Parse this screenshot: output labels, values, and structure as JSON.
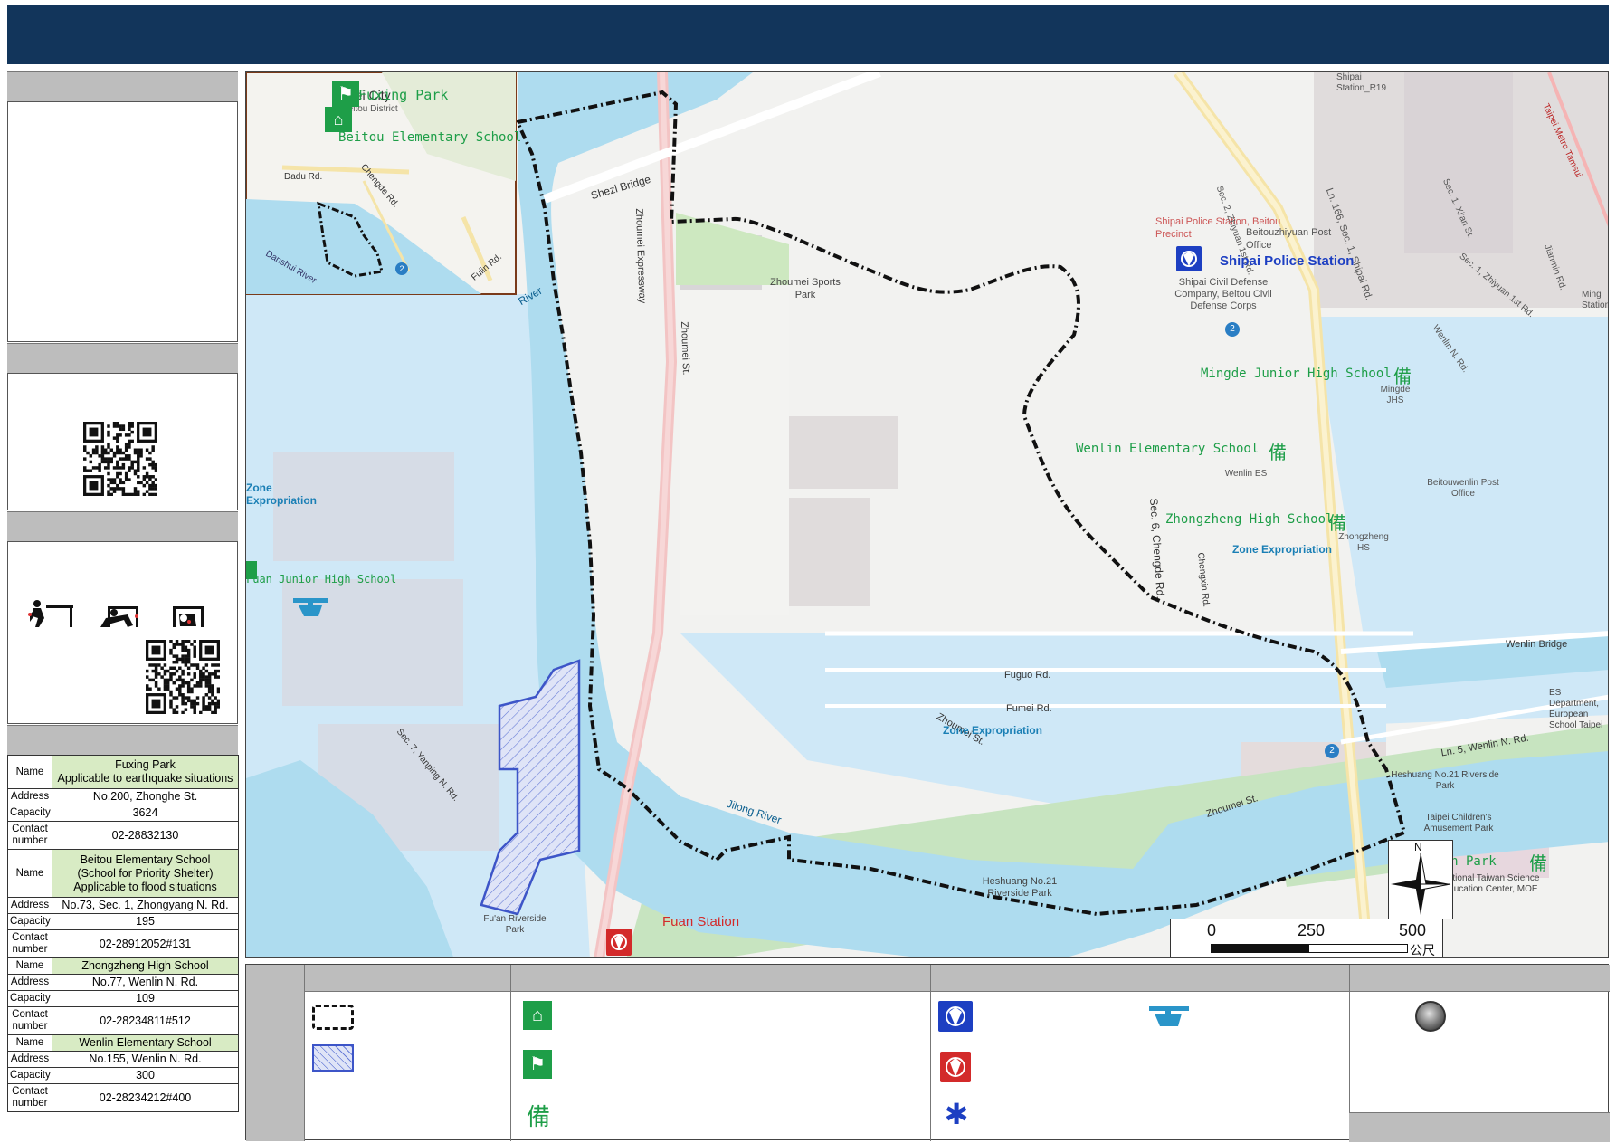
{
  "map": {
    "labels": {
      "fuxing_park": "Fuxing Park",
      "beitou_es": "Beitou Elementary School",
      "taipei_city": "Taipei City",
      "beitou_district": "Beitou District",
      "dadu_rd": "Dadu Rd.",
      "chengde_rd_inset": "Chengde Rd.",
      "danshui_river": "Danshui River",
      "fulin_rd": "Fulin Rd.",
      "shezi_bridge": "Shezi Bridge",
      "zhoumei_expwy": "Zhoumei Expressway",
      "zhoumei_st": "Zhoumei St.",
      "zhoumei_sports_park": "Zhoumei Sports Park",
      "shipai_police_station_small": "Shipai Police Station, Beitou Precinct",
      "shipai_post": "Beitouzhiyuan Post Office",
      "shipai_police_station": "Shipai Police Station",
      "civil_defense": "Shipai Civil Defense Company, Beitou Civil Defense Corps",
      "mingde_jhs": "Mingde Junior High School",
      "wenlin_es": "Wenlin Elementary School",
      "zhongzheng_hs": "Zhongzheng High School",
      "zone_expropriation": "Zone Expropriation",
      "fuan_jhs": "Fuan Junior High School",
      "fuguo_rd": "Fuguo Rd.",
      "fumei_rd": "Fumei Rd.",
      "zhoumei_st2": "Zhoumei St.",
      "jilong_river": "Jilong River",
      "heshuang_park": "Heshuang No.21 Riverside Park",
      "fuan_station": "Fuan Station",
      "fuan_riverside": "Fu'an Riverside Park",
      "yanping_rd": "Sec. 7, Yanping N. Rd.",
      "meilun_park": "Meilun Park",
      "wenlin_bridge": "Wenlin Bridge",
      "wenlin_rd": "Ln. 5, Wenlin N. Rd.",
      "chengde_rd": "Sec. 6, Chengde Rd.",
      "chengxin_rd": "Chengxin Rd.",
      "metro": "Taipei Metro Tamsui",
      "ntsec": "National Taiwan Science Education Center, MOE",
      "children_park": "Taipei Children's Amusement Park",
      "heshuang_park2": "Heshuang No.21 Riverside Park",
      "wenlin_post": "Beitouwenlin Post Office",
      "mingde_short": "Mingde JHS",
      "wenlin_short": "Wenlin ES",
      "zhongzheng_short": "Zhongzheng HS",
      "shipai_station": "Shipai Station_R19",
      "zhiyuan": "Sec. 2, Zhiyuan 1st Rd.",
      "shipai_rd": "Ln. 166, Sec. 1, Shipai Rd.",
      "xian_st": "Sec. 1, Xi'an St.",
      "zhiyuan1": "Sec. 1, Zhiyuan 1st Rd.",
      "jianmin_rd": "Jianmin Rd.",
      "wenlin_n": "Wenlin N. Rd.",
      "es_dept": "ES Department, European School Taipei",
      "ming_station": "Ming Station",
      "zone_exp_left": "Zone Expropriation",
      "riv": "River"
    },
    "scale": {
      "zero": "0",
      "mid": "250",
      "max": "500",
      "unit": "公尺"
    },
    "north": "N"
  },
  "table": {
    "keys": {
      "name": "Name",
      "address": "Address",
      "capacity": "Capacity",
      "contact": "Contact number"
    },
    "shelters": [
      {
        "name": "Fuxing Park",
        "note": "Applicable to earthquake situations",
        "address": "No.200, Zhonghe St.",
        "capacity": "3624",
        "contact": "02-28832130"
      },
      {
        "name": "Beitou Elementary School",
        "note": "(School for Priority Shelter)",
        "note2": "Applicable to flood situations",
        "address": "No.73, Sec. 1, Zhongyang N. Rd.",
        "capacity": "195",
        "contact": "02-28912052#131"
      },
      {
        "name": "Zhongzheng High School",
        "address": "No.77, Wenlin N. Rd.",
        "capacity": "109",
        "contact": "02-28234811#512"
      },
      {
        "name": "Wenlin Elementary School",
        "address": "No.155, Wenlin N. Rd.",
        "capacity": "300",
        "contact": "02-28234212#400"
      }
    ]
  },
  "legend": {
    "reserve_glyph": "備"
  },
  "colors": {
    "banner": "#12355b",
    "water": "#aedcef",
    "zone": "#cfe8f7",
    "boundary": "#111111",
    "hatch": "#3d55c8",
    "shelter_green": "#1e9e48",
    "police_blue": "#1d3fc2",
    "fire_red": "#d32a2a"
  }
}
